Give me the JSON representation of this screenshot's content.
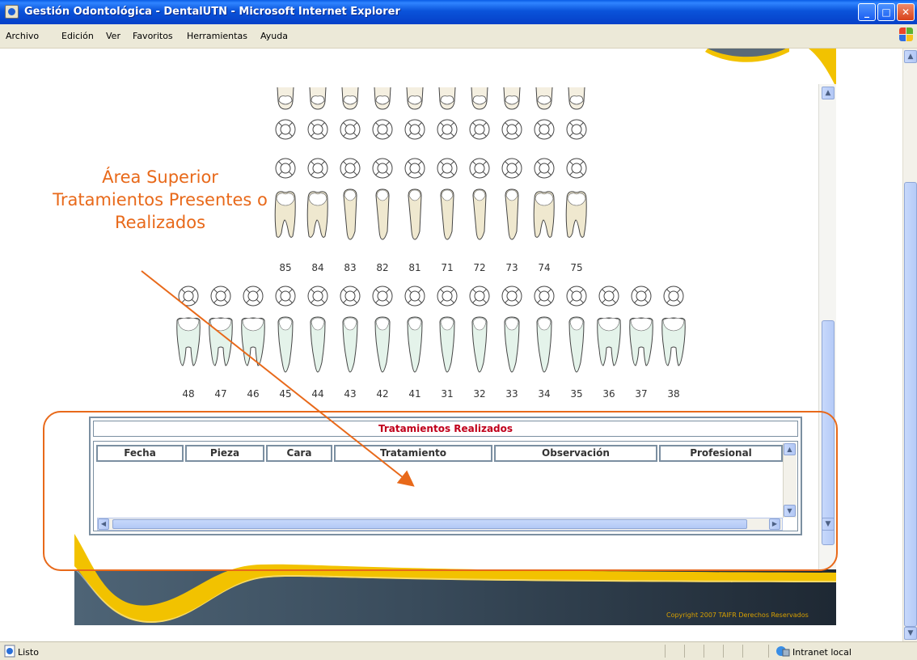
{
  "window": {
    "title": "Gestión Odontológica - DentalUTN - Microsoft Internet Explorer",
    "minimize": "_",
    "maximize": "□",
    "close": "✕"
  },
  "menu": [
    "Archivo",
    "Edición",
    "Ver",
    "Favoritos",
    "Herramientas",
    "Ayuda"
  ],
  "annotation": {
    "lines": [
      "Área Superior",
      "Tratamientos Presentes o",
      "Realizados"
    ],
    "color": "#e8691a"
  },
  "teeth": {
    "upper_temporary_numbers": [
      "85",
      "84",
      "83",
      "82",
      "81",
      "71",
      "72",
      "73",
      "74",
      "75"
    ],
    "lower_permanent_numbers": [
      "48",
      "47",
      "46",
      "45",
      "44",
      "43",
      "42",
      "41",
      "31",
      "32",
      "33",
      "34",
      "35",
      "36",
      "37",
      "38"
    ]
  },
  "treatments": {
    "title": "Tratamientos Realizados",
    "title_color": "#c0001b",
    "columns": [
      "Fecha",
      "Pieza",
      "Cara",
      "Tratamiento",
      "Observación",
      "Profesional"
    ],
    "rows": []
  },
  "footer": {
    "copyright": "Copyright 2007 TAIFR Derechos Reservados"
  },
  "status": {
    "text": "Listo",
    "zone": "Intranet local"
  },
  "icons": [
    "ie-page-icon",
    "windows-logo-icon",
    "scroll-up-icon",
    "scroll-down-icon",
    "intranet-zone-icon"
  ]
}
